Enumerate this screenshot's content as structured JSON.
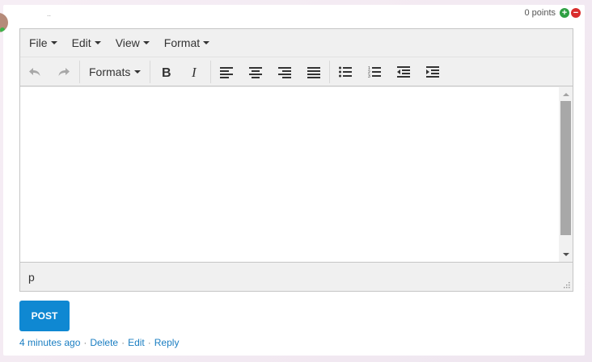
{
  "comment": {
    "author_placeholder": "..",
    "points_label": "0 points"
  },
  "menubar": {
    "items": [
      "File",
      "Edit",
      "View",
      "Format"
    ]
  },
  "toolbar": {
    "formats_label": "Formats",
    "buttons": [
      "undo-icon",
      "redo-icon",
      "bold-icon",
      "italic-icon",
      "align-left-icon",
      "align-center-icon",
      "align-right-icon",
      "align-justify-icon",
      "bullet-list-icon",
      "numbered-list-icon",
      "outdent-icon",
      "indent-icon"
    ]
  },
  "statusbar": {
    "path": "p"
  },
  "actions": {
    "post_label": "POST"
  },
  "meta": {
    "time": "4 minutes ago",
    "sep": "·",
    "delete": "Delete",
    "edit": "Edit",
    "reply": "Reply"
  },
  "colors": {
    "post_button": "#0f88d2",
    "link": "#1a7ec2",
    "vote_up": "#2ea043",
    "vote_down": "#d92c2c"
  }
}
